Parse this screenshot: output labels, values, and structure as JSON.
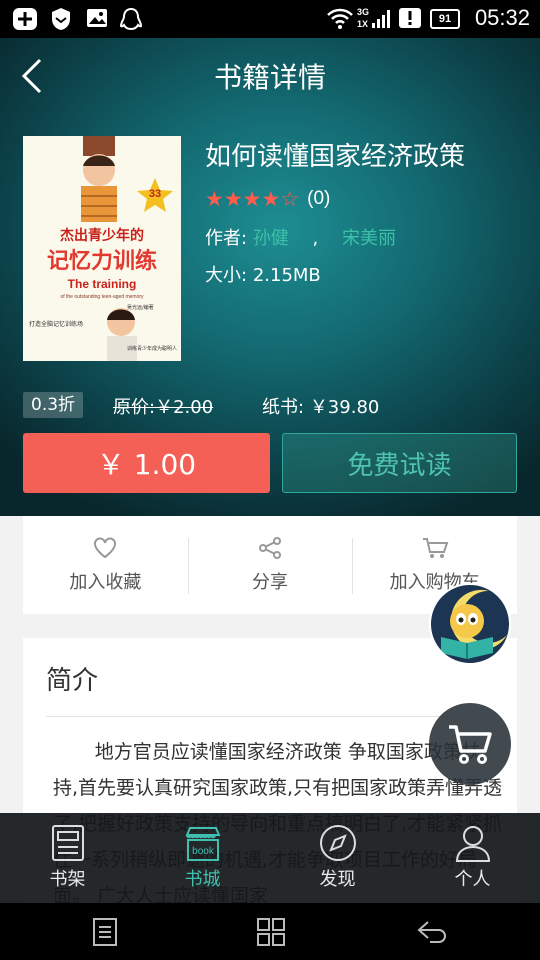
{
  "status_bar": {
    "time": "05:32",
    "battery": "91",
    "network_top": "3G",
    "network_bottom": "1X",
    "icons": [
      "add-box-icon",
      "shield-icon",
      "image-icon",
      "qq-penguin-icon",
      "wifi-icon",
      "signal-icon",
      "alert-icon"
    ]
  },
  "header": {
    "title": "书籍详情",
    "back_icon": "chevron-left-icon"
  },
  "book": {
    "title": "如何读懂国家经济政策",
    "rating": 4,
    "rating_max": 5,
    "rating_count": "(0)",
    "author_label": "作者:",
    "authors": [
      "孙健",
      "宋美丽"
    ],
    "author_separator": ",",
    "size_label": "大小:",
    "size": "2.15MB",
    "cover": {
      "main_title": "杰出青少年的",
      "sub_title": "记忆力训练",
      "english_1": "The training",
      "english_2": "of the outstanding teen-aged memory",
      "badge": "33",
      "tagline": "打造全脑记忆训练场",
      "tagline_2": "训练青少年成为聪明人",
      "editor": "吴光远/编著"
    }
  },
  "pricing": {
    "discount": "0.3折",
    "original_label": "原价:",
    "original_price": "￥2.00",
    "paper_label": "纸书:",
    "paper_price": "￥39.80"
  },
  "buttons": {
    "buy": "￥ 1.00",
    "trial": "免费试读"
  },
  "actions": [
    {
      "label": "加入收藏",
      "icon": "heart-icon"
    },
    {
      "label": "分享",
      "icon": "share-icon"
    },
    {
      "label": "加入购物车",
      "icon": "cart-icon"
    }
  ],
  "intro": {
    "title": "简介",
    "text": "地方官员应读懂国家经济政策 争取国家政策扶持,首先要认真研究国家政策,只有把国家政策弄懂弄透了,把握好政策支持的导向和重点搞明白了,才能紧紧抓住一系列稍纵即逝的机遇,才能争取项目工作的好局面。 广大人士应读懂国家"
  },
  "tabs": [
    {
      "label": "书架",
      "icon": "bookshelf-icon",
      "active": false
    },
    {
      "label": "书城",
      "icon": "bookstore-icon",
      "active": true
    },
    {
      "label": "发现",
      "icon": "compass-icon",
      "active": false
    },
    {
      "label": "个人",
      "icon": "person-icon",
      "active": false
    }
  ],
  "colors": {
    "accent": "#3fc0b0",
    "buy": "#f45f56",
    "star": "#ff5c4d",
    "author_link": "#3cc0a6"
  }
}
